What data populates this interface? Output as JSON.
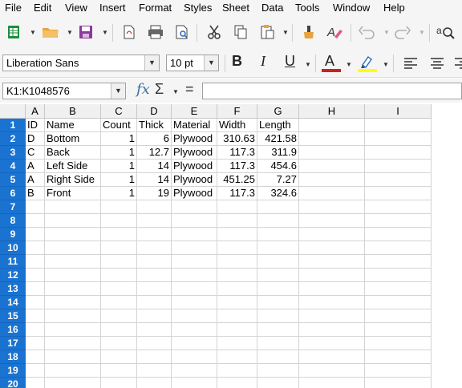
{
  "menu": [
    "File",
    "Edit",
    "View",
    "Insert",
    "Format",
    "Styles",
    "Sheet",
    "Data",
    "Tools",
    "Window",
    "Help"
  ],
  "toolbar": {
    "font_name": "Liberation Sans",
    "font_size": "10 pt",
    "bold": "B",
    "italic": "I",
    "underline": "U",
    "font_color_letter": "A",
    "font_color": "#c9211e",
    "highlight_color": "#ffff00"
  },
  "formula_bar": {
    "name_box": "K1:K1048576",
    "fx_label": "fx",
    "sigma_label": "Σ",
    "equals_label": "=",
    "formula": ""
  },
  "columns": [
    "A",
    "B",
    "C",
    "D",
    "E",
    "F",
    "G",
    "H",
    "I"
  ],
  "row_numbers": [
    "1",
    "2",
    "3",
    "4",
    "5",
    "6",
    "7",
    "8",
    "9",
    "10",
    "11",
    "12",
    "13",
    "14",
    "15",
    "16",
    "17",
    "18",
    "19",
    "20"
  ],
  "rows": [
    [
      "ID",
      "Name",
      "Count",
      "Thick",
      "Material",
      "Width",
      "Length",
      "",
      ""
    ],
    [
      "D",
      "Bottom",
      "1",
      "6",
      "Plywood",
      "310.63",
      "421.58",
      "",
      ""
    ],
    [
      "C",
      "Back",
      "1",
      "12.7",
      "Plywood",
      "117.3",
      "311.9",
      "",
      ""
    ],
    [
      "A",
      "Left Side",
      "1",
      "14",
      "Plywood",
      "117.3",
      "454.6",
      "",
      ""
    ],
    [
      "A",
      "Right Side",
      "1",
      "14",
      "Plywood",
      "451.25",
      "7.27",
      "",
      ""
    ],
    [
      "B",
      "Front",
      "1",
      "19",
      "Plywood",
      "117.3",
      "324.6",
      "",
      ""
    ]
  ],
  "colors": {
    "row_header_selected": "#1a73d0",
    "toolbar_bg": "#f5f5f5"
  }
}
